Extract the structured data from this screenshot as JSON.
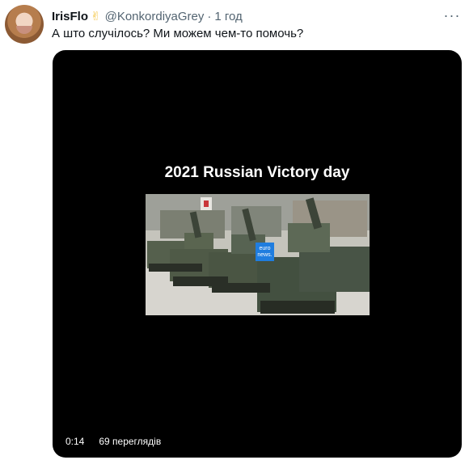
{
  "tweet": {
    "display_name": "IrisFlo",
    "emoji": "✌",
    "handle": "@KonkordiyaGrey",
    "separator": "·",
    "time": "1 год",
    "more": "···",
    "text": "А што случілось? Ми можем чем-то помочь?"
  },
  "video": {
    "title": "2021 Russian Victory day",
    "badge_text": "euro news.",
    "duration": "0:14",
    "views": "69 переглядів"
  },
  "colors": {
    "accent_blue": "#1f7ddf",
    "text": "#0f1419",
    "secondary": "#536471",
    "media_bg": "#000000"
  }
}
